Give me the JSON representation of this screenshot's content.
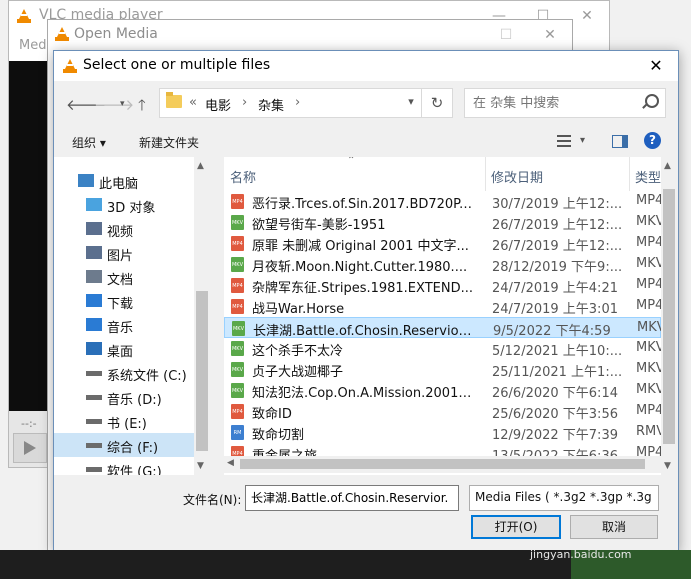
{
  "vlc": {
    "title": "VLC media player",
    "menu": "Med",
    "seek_label": "--:-"
  },
  "open_media": {
    "title": "Open Media"
  },
  "dialog": {
    "title": "Select one or multiple files",
    "close": "✕",
    "breadcrumb": {
      "prefix": "«",
      "part1": "电影",
      "sep": "›",
      "part2": "杂集",
      "sep2": "›"
    },
    "search_placeholder": "在 杂集 中搜索",
    "toolbar": {
      "organize": "组织 ▾",
      "new_folder": "新建文件夹"
    },
    "columns": {
      "name": "名称",
      "date": "修改日期",
      "type": "类型"
    },
    "nav_items": [
      {
        "label": "此电脑",
        "icon": "computer-icon"
      },
      {
        "label": "3D 对象",
        "icon": "cube-icon"
      },
      {
        "label": "视频",
        "icon": "video-folder-icon"
      },
      {
        "label": "图片",
        "icon": "pictures-folder-icon"
      },
      {
        "label": "文档",
        "icon": "documents-folder-icon"
      },
      {
        "label": "下载",
        "icon": "download-icon"
      },
      {
        "label": "音乐",
        "icon": "music-icon"
      },
      {
        "label": "桌面",
        "icon": "desktop-icon"
      },
      {
        "label": "系统文件 (C:)",
        "icon": "drive-icon"
      },
      {
        "label": "音乐 (D:)",
        "icon": "drive-icon"
      },
      {
        "label": "书 (E:)",
        "icon": "drive-icon"
      },
      {
        "label": "综合 (F:)",
        "icon": "drive-icon"
      },
      {
        "label": "软件 (G:)",
        "icon": "drive-icon"
      }
    ],
    "files": [
      {
        "name": "恶行录.Trces.of.Sin.2017.BD720P....",
        "date": "30/7/2019 上午12:...",
        "type": "MP4",
        "ext": "MP4"
      },
      {
        "name": "欲望号街车-美影-1951",
        "date": "26/7/2019 上午12:...",
        "type": "MKV",
        "ext": "MKV"
      },
      {
        "name": "原罪 未删减 Original 2001 中文字...",
        "date": "26/7/2019 上午12:...",
        "type": "MP4",
        "ext": "MP4"
      },
      {
        "name": "月夜斩.Moon.Night.Cutter.1980....",
        "date": "28/12/2019 下午9:...",
        "type": "MKV",
        "ext": "MKV"
      },
      {
        "name": "杂牌军东征.Stripes.1981.EXTEND...",
        "date": "24/7/2019 上午4:21",
        "type": "MP4",
        "ext": "MP4"
      },
      {
        "name": "战马War.Horse",
        "date": "24/7/2019 上午3:01",
        "type": "MP4",
        "ext": "MP4"
      },
      {
        "name": "长津湖.Battle.of.Chosin.Reservior....",
        "date": "9/5/2022 下午4:59",
        "type": "MKV",
        "ext": "MKV"
      },
      {
        "name": "这个杀手不太冷",
        "date": "5/12/2021 上午10:...",
        "type": "MKV",
        "ext": "MKV"
      },
      {
        "name": "贞子大战迦椰子",
        "date": "25/11/2021 上午1:...",
        "type": "MKV",
        "ext": "MKV"
      },
      {
        "name": "知法犯法.Cop.On.A.Mission.2001....",
        "date": "26/6/2020 下午6:14",
        "type": "MKV",
        "ext": "MKV"
      },
      {
        "name": "致命ID",
        "date": "25/6/2020 下午3:56",
        "type": "MP4",
        "ext": "MP4"
      },
      {
        "name": "致命切割",
        "date": "12/9/2022 下午7:39",
        "type": "RMV",
        "ext": "RM"
      },
      {
        "name": "重金属之旅",
        "date": "13/5/2022 下午6:36",
        "type": "MP4",
        "ext": "MP4"
      }
    ],
    "filename_label": "文件名(N):",
    "filename_value": "长津湖.Battle.of.Chosin.Reservior.",
    "filetype": "Media Files ( *.3g2 *.3gp *.3g",
    "open_button": "打开(O)",
    "cancel_button": "取消"
  },
  "watermark": "jingyan.baidu.com",
  "colors": {
    "accent": "#0078d7",
    "selection": "#cce8ff",
    "mp4": "#e05a3f",
    "mkv": "#5aa84a",
    "rm": "#3d7fd0"
  }
}
